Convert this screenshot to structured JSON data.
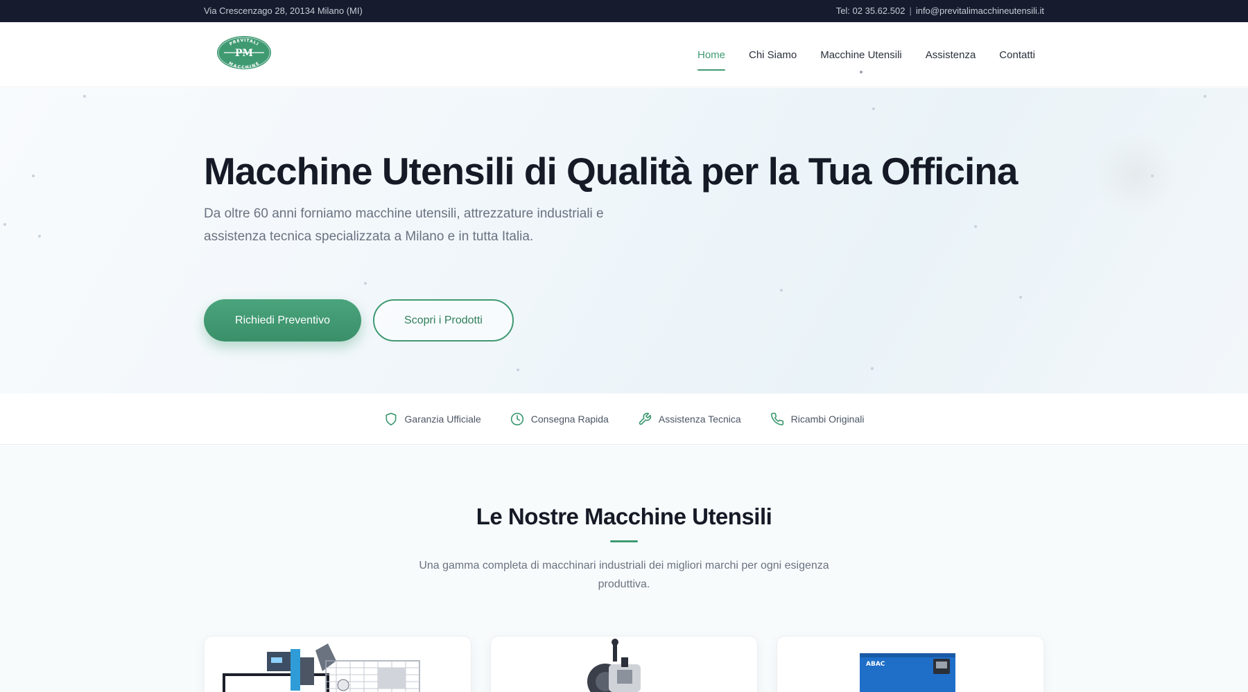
{
  "topbar": {
    "address": "Via Crescenzago 28, 20134 Milano (MI)",
    "phone": "Tel: 02 35.62.502",
    "separator": "|",
    "email": "info@previtalimacchineutensili.it"
  },
  "logo": {
    "top_text": "PREVITALI",
    "bottom_text": "MACCHINE",
    "monogram": "PM"
  },
  "nav": {
    "items": [
      {
        "label": "Home",
        "active": true
      },
      {
        "label": "Chi Siamo",
        "active": false
      },
      {
        "label": "Macchine Utensili",
        "active": false
      },
      {
        "label": "Assistenza",
        "active": false
      },
      {
        "label": "Contatti",
        "active": false
      }
    ]
  },
  "hero": {
    "title": "Macchine Utensili di Qualità per la Tua Officina",
    "subtitle": "Da oltre 60 anni forniamo macchine utensili, attrezzature industriali e assistenza tecnica specializzata a Milano e in tutta Italia.",
    "primary_button": "Richiedi Preventivo",
    "secondary_button": "Scopri i Prodotti"
  },
  "features": [
    {
      "icon": "shield-icon",
      "label": "Garanzia Ufficiale"
    },
    {
      "icon": "clock-icon",
      "label": "Consegna Rapida"
    },
    {
      "icon": "wrench-icon",
      "label": "Assistenza Tecnica"
    },
    {
      "icon": "phone-icon",
      "label": "Ricambi Originali"
    }
  ],
  "products": {
    "title": "Le Nostre Macchine Utensili",
    "subtitle": "Una gamma completa di macchinari industriali dei migliori marchi per ogni esigenza produttiva.",
    "cards": [
      {
        "image": "bandsaw-machine-image"
      },
      {
        "image": "bench-grinder-image"
      },
      {
        "image": "air-compressor-image",
        "brand_text": "ABAC"
      }
    ]
  },
  "colors": {
    "accent": "#3f9a72",
    "topbar_bg": "#161b2e",
    "heading": "#151a26",
    "muted": "#6b7280"
  }
}
